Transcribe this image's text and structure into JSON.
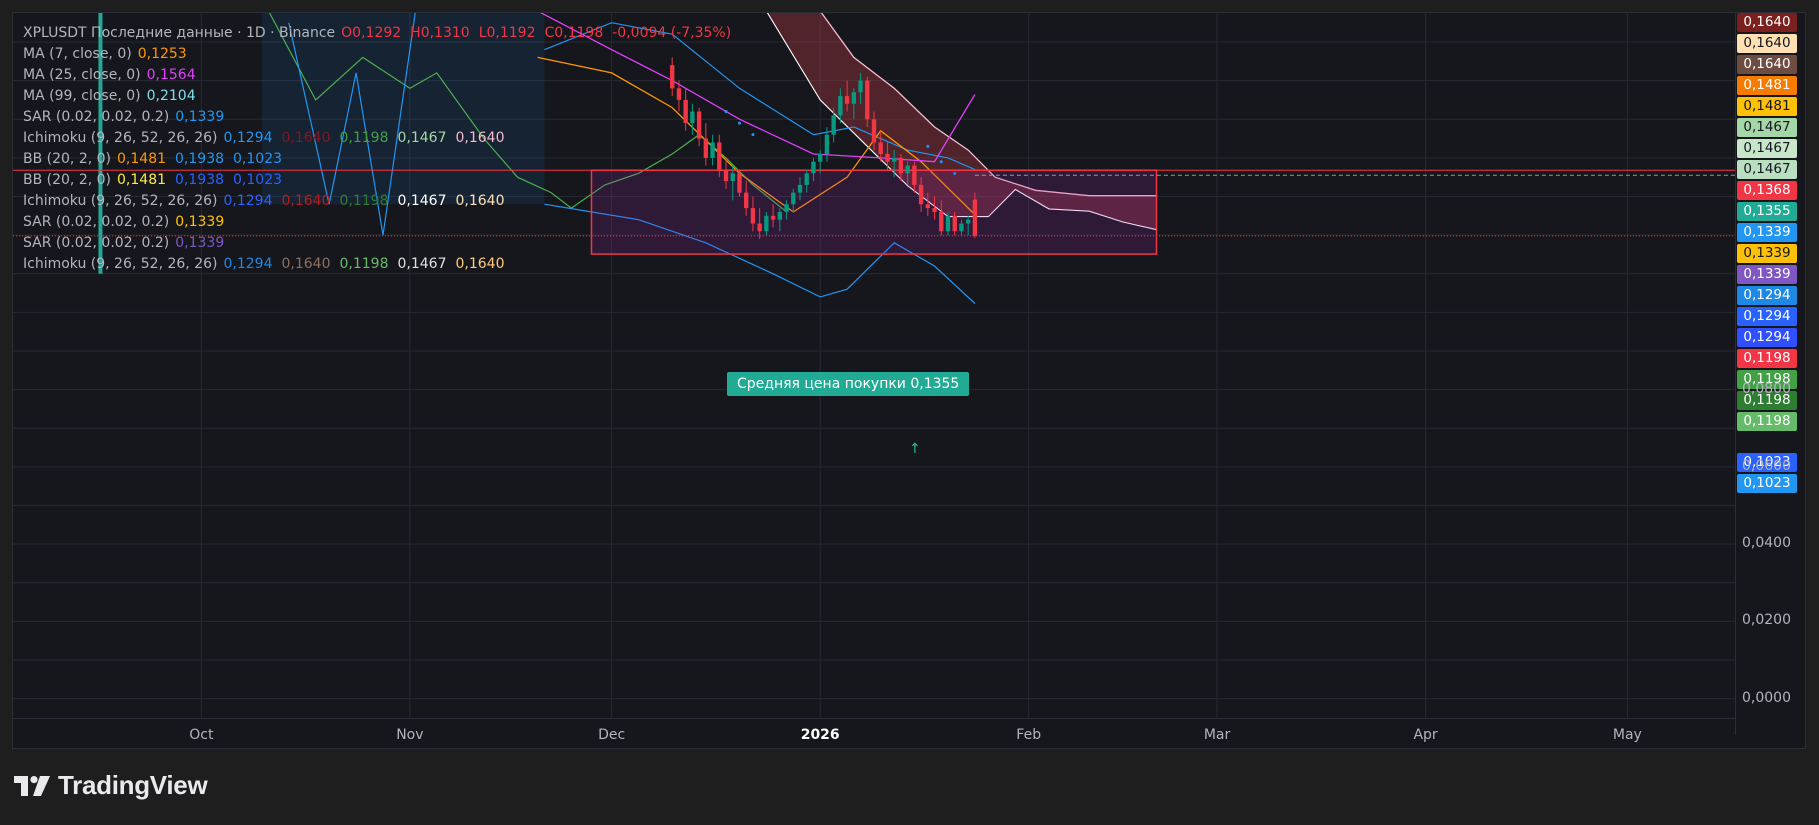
{
  "legend": [
    {
      "name": "XPLUSDT Последние данные · 1D · Binance",
      "parts": [
        {
          "t": "O0,1292",
          "c": "#f23645"
        },
        {
          "t": "H0,1310",
          "c": "#f23645"
        },
        {
          "t": "L0,1192",
          "c": "#f23645"
        },
        {
          "t": "C0,1198",
          "c": "#f23645"
        },
        {
          "t": "-0,0094 (-7,35%)",
          "c": "#f23645"
        }
      ]
    },
    {
      "name": "MA (7, close, 0)",
      "parts": [
        {
          "t": "0,1253",
          "c": "#ff9800"
        }
      ]
    },
    {
      "name": "MA (25, close, 0)",
      "parts": [
        {
          "t": "0,1564",
          "c": "#e040fb"
        }
      ]
    },
    {
      "name": "MA (99, close, 0)",
      "parts": [
        {
          "t": "0,2104",
          "c": "#80deea"
        }
      ]
    },
    {
      "name": "SAR (0.02, 0.02, 0.2)",
      "parts": [
        {
          "t": "0,1339",
          "c": "#2196f3"
        }
      ]
    },
    {
      "name": "Ichimoku (9, 26, 52, 26, 26)",
      "parts": [
        {
          "t": "0,1294",
          "c": "#2196f3"
        },
        {
          "t": "0,1640",
          "c": "#801922"
        },
        {
          "t": "0,1198",
          "c": "#43a047"
        },
        {
          "t": "0,1467",
          "c": "#a5d6a7"
        },
        {
          "t": "0,1640",
          "c": "#f8bbd0"
        }
      ]
    },
    {
      "name": "BB (20, 2, 0)",
      "parts": [
        {
          "t": "0,1481",
          "c": "#ff9800"
        },
        {
          "t": "0,1938",
          "c": "#2196f3"
        },
        {
          "t": "0,1023",
          "c": "#2196f3"
        }
      ]
    },
    {
      "name": "BB (20, 2, 0)",
      "parts": [
        {
          "t": "0,1481",
          "c": "#ffeb3b"
        },
        {
          "t": "0,1938",
          "c": "#2962ff"
        },
        {
          "t": "0,1023",
          "c": "#2962ff"
        }
      ]
    },
    {
      "name": "Ichimoku (9, 26, 52, 26, 26)",
      "parts": [
        {
          "t": "0,1294",
          "c": "#2962ff"
        },
        {
          "t": "0,1640",
          "c": "#b71c1c"
        },
        {
          "t": "0,1198",
          "c": "#2e7d32"
        },
        {
          "t": "0,1467",
          "c": "#ffffff"
        },
        {
          "t": "0,1640",
          "c": "#ffe0b2"
        }
      ]
    },
    {
      "name": "SAR (0.02, 0.02, 0.2)",
      "parts": [
        {
          "t": "0,1339",
          "c": "#ffc107"
        }
      ]
    },
    {
      "name": "SAR (0.02, 0.02, 0.2)",
      "parts": [
        {
          "t": "0,1339",
          "c": "#7e57c2"
        }
      ]
    },
    {
      "name": "Ichimoku (9, 26, 52, 26, 26)",
      "parts": [
        {
          "t": "0,1294",
          "c": "#1e88e5"
        },
        {
          "t": "0,1640",
          "c": "#8d6e63"
        },
        {
          "t": "0,1198",
          "c": "#66bb6a"
        },
        {
          "t": "0,1467",
          "c": "#e0e0e0"
        },
        {
          "t": "0,1640",
          "c": "#ffcc80"
        }
      ]
    }
  ],
  "price_labels": [
    {
      "v": "0,1640",
      "bg": "#7b1f1f",
      "fg": "#ffffff"
    },
    {
      "v": "0,1640",
      "bg": "#ffe0b2",
      "fg": "#131722"
    },
    {
      "v": "0,1640",
      "bg": "#6d4c41",
      "fg": "#ffffff"
    },
    {
      "v": "0,1481",
      "bg": "#f57c00",
      "fg": "#ffffff"
    },
    {
      "v": "0,1481",
      "bg": "#ffc107",
      "fg": "#131722"
    },
    {
      "v": "0,1467",
      "bg": "#a5d6a7",
      "fg": "#131722"
    },
    {
      "v": "0,1467",
      "bg": "#c8e6c9",
      "fg": "#131722"
    },
    {
      "v": "0,1467",
      "bg": "#b9dfc0",
      "fg": "#131722"
    },
    {
      "v": "0,1368",
      "bg": "#f23645",
      "fg": "#ffffff"
    },
    {
      "v": "0,1355",
      "bg": "#22ab94",
      "fg": "#ffffff"
    },
    {
      "v": "0,1339",
      "bg": "#2196f3",
      "fg": "#ffffff"
    },
    {
      "v": "0,1339",
      "bg": "#ffc107",
      "fg": "#131722"
    },
    {
      "v": "0,1339",
      "bg": "#7e57c2",
      "fg": "#ffffff"
    },
    {
      "v": "0,1294",
      "bg": "#1e88e5",
      "fg": "#ffffff"
    },
    {
      "v": "0,1294",
      "bg": "#2962ff",
      "fg": "#ffffff"
    },
    {
      "v": "0,1294",
      "bg": "#304ffe",
      "fg": "#ffffff"
    },
    {
      "v": "0,1198",
      "bg": "#f23645",
      "fg": "#ffffff"
    },
    {
      "v": "0,1198",
      "bg": "#43a047",
      "fg": "#ffffff"
    },
    {
      "v": "0,1198",
      "bg": "#2e7d32",
      "fg": "#ffffff"
    },
    {
      "v": "0,1198",
      "bg": "#66bb6a",
      "fg": "#ffffff"
    },
    {
      "v": "0,1023",
      "bg": "#2962ff",
      "fg": "#ffffff"
    },
    {
      "v": "0,1023",
      "bg": "#2196f3",
      "fg": "#ffffff"
    }
  ],
  "buy_label": "Средняя цена покупки 0,1355",
  "brand": "TradingView",
  "chart_data": {
    "type": "candlestick",
    "symbol": "XPLUSDT",
    "timeframe": "1D",
    "exchange": "Binance",
    "y_ticks": [
      "0,0800",
      "0,0600",
      "0,0400",
      "0,0200",
      "0,0000"
    ],
    "y_tick_values": [
      0.08,
      0.06,
      0.04,
      0.02,
      0.0
    ],
    "x_ticks": [
      {
        "label": "Oct",
        "date": "2025-10-01"
      },
      {
        "label": "Nov",
        "date": "2025-11-01"
      },
      {
        "label": "Dec",
        "date": "2025-12-01"
      },
      {
        "label": "2026",
        "date": "2026-01-01",
        "bold": true
      },
      {
        "label": "Feb",
        "date": "2026-02-01"
      },
      {
        "label": "Mar",
        "date": "2026-03-01"
      },
      {
        "label": "Apr",
        "date": "2026-04-01"
      },
      {
        "label": "May",
        "date": "2026-05-01"
      }
    ],
    "y_range": [
      -0.005,
      0.1775
    ],
    "x_range": [
      "2025-09-03",
      "2026-05-17"
    ],
    "last_close": 0.1198,
    "avg_buy_price": 0.1355,
    "rectangle": {
      "from": "2025-11-28",
      "to": "2026-02-20",
      "top": 0.1368,
      "bottom": 0.1151
    },
    "candles": [
      {
        "date": "2025-12-10",
        "o": 0.164,
        "h": 0.166,
        "l": 0.156,
        "c": 0.158
      },
      {
        "date": "2025-12-11",
        "o": 0.158,
        "h": 0.16,
        "l": 0.152,
        "c": 0.155
      },
      {
        "date": "2025-12-12",
        "o": 0.155,
        "h": 0.158,
        "l": 0.147,
        "c": 0.149
      },
      {
        "date": "2025-12-13",
        "o": 0.149,
        "h": 0.154,
        "l": 0.146,
        "c": 0.152
      },
      {
        "date": "2025-12-14",
        "o": 0.152,
        "h": 0.153,
        "l": 0.143,
        "c": 0.145
      },
      {
        "date": "2025-12-15",
        "o": 0.145,
        "h": 0.149,
        "l": 0.138,
        "c": 0.14
      },
      {
        "date": "2025-12-16",
        "o": 0.14,
        "h": 0.146,
        "l": 0.138,
        "c": 0.144
      },
      {
        "date": "2025-12-17",
        "o": 0.144,
        "h": 0.146,
        "l": 0.135,
        "c": 0.137
      },
      {
        "date": "2025-12-18",
        "o": 0.137,
        "h": 0.14,
        "l": 0.132,
        "c": 0.134
      },
      {
        "date": "2025-12-19",
        "o": 0.134,
        "h": 0.138,
        "l": 0.129,
        "c": 0.136
      },
      {
        "date": "2025-12-20",
        "o": 0.136,
        "h": 0.137,
        "l": 0.13,
        "c": 0.131
      },
      {
        "date": "2025-12-21",
        "o": 0.131,
        "h": 0.134,
        "l": 0.125,
        "c": 0.127
      },
      {
        "date": "2025-12-22",
        "o": 0.127,
        "h": 0.13,
        "l": 0.121,
        "c": 0.123
      },
      {
        "date": "2025-12-23",
        "o": 0.123,
        "h": 0.127,
        "l": 0.119,
        "c": 0.121
      },
      {
        "date": "2025-12-24",
        "o": 0.121,
        "h": 0.126,
        "l": 0.12,
        "c": 0.125
      },
      {
        "date": "2025-12-25",
        "o": 0.125,
        "h": 0.128,
        "l": 0.122,
        "c": 0.124
      },
      {
        "date": "2025-12-26",
        "o": 0.124,
        "h": 0.127,
        "l": 0.121,
        "c": 0.126
      },
      {
        "date": "2025-12-27",
        "o": 0.126,
        "h": 0.129,
        "l": 0.124,
        "c": 0.128
      },
      {
        "date": "2025-12-28",
        "o": 0.128,
        "h": 0.132,
        "l": 0.126,
        "c": 0.131
      },
      {
        "date": "2025-12-29",
        "o": 0.131,
        "h": 0.135,
        "l": 0.129,
        "c": 0.133
      },
      {
        "date": "2025-12-30",
        "o": 0.133,
        "h": 0.137,
        "l": 0.131,
        "c": 0.136
      },
      {
        "date": "2025-12-31",
        "o": 0.136,
        "h": 0.14,
        "l": 0.134,
        "c": 0.139
      },
      {
        "date": "2026-01-01",
        "o": 0.139,
        "h": 0.142,
        "l": 0.136,
        "c": 0.141
      },
      {
        "date": "2026-01-02",
        "o": 0.141,
        "h": 0.148,
        "l": 0.139,
        "c": 0.146
      },
      {
        "date": "2026-01-03",
        "o": 0.146,
        "h": 0.153,
        "l": 0.144,
        "c": 0.151
      },
      {
        "date": "2026-01-04",
        "o": 0.151,
        "h": 0.158,
        "l": 0.149,
        "c": 0.156
      },
      {
        "date": "2026-01-05",
        "o": 0.156,
        "h": 0.16,
        "l": 0.152,
        "c": 0.154
      },
      {
        "date": "2026-01-06",
        "o": 0.154,
        "h": 0.158,
        "l": 0.15,
        "c": 0.157
      },
      {
        "date": "2026-01-07",
        "o": 0.157,
        "h": 0.162,
        "l": 0.154,
        "c": 0.16
      },
      {
        "date": "2026-01-08",
        "o": 0.16,
        "h": 0.161,
        "l": 0.148,
        "c": 0.15
      },
      {
        "date": "2026-01-09",
        "o": 0.15,
        "h": 0.152,
        "l": 0.142,
        "c": 0.144
      },
      {
        "date": "2026-01-10",
        "o": 0.144,
        "h": 0.147,
        "l": 0.139,
        "c": 0.141
      },
      {
        "date": "2026-01-11",
        "o": 0.141,
        "h": 0.144,
        "l": 0.137,
        "c": 0.139
      },
      {
        "date": "2026-01-12",
        "o": 0.139,
        "h": 0.142,
        "l": 0.135,
        "c": 0.14
      },
      {
        "date": "2026-01-13",
        "o": 0.14,
        "h": 0.141,
        "l": 0.134,
        "c": 0.136
      },
      {
        "date": "2026-01-14",
        "o": 0.136,
        "h": 0.139,
        "l": 0.133,
        "c": 0.138
      },
      {
        "date": "2026-01-15",
        "o": 0.138,
        "h": 0.139,
        "l": 0.131,
        "c": 0.133
      },
      {
        "date": "2026-01-16",
        "o": 0.133,
        "h": 0.135,
        "l": 0.126,
        "c": 0.128
      },
      {
        "date": "2026-01-17",
        "o": 0.128,
        "h": 0.131,
        "l": 0.125,
        "c": 0.127
      },
      {
        "date": "2026-01-18",
        "o": 0.127,
        "h": 0.13,
        "l": 0.124,
        "c": 0.126
      },
      {
        "date": "2026-01-19",
        "o": 0.126,
        "h": 0.129,
        "l": 0.12,
        "c": 0.121
      },
      {
        "date": "2026-01-20",
        "o": 0.121,
        "h": 0.126,
        "l": 0.12,
        "c": 0.125
      },
      {
        "date": "2026-01-21",
        "o": 0.125,
        "h": 0.126,
        "l": 0.12,
        "c": 0.121
      },
      {
        "date": "2026-01-22",
        "o": 0.121,
        "h": 0.124,
        "l": 0.12,
        "c": 0.123
      },
      {
        "date": "2026-01-23",
        "o": 0.123,
        "h": 0.125,
        "l": 0.12,
        "c": 0.124
      },
      {
        "date": "2026-01-24",
        "o": 0.1292,
        "h": 0.131,
        "l": 0.1192,
        "c": 0.1198
      }
    ],
    "series": [
      {
        "name": "MA (7, close, 0)",
        "color": "#ff9800",
        "points": [
          [
            "2025-11-20",
            0.166
          ],
          [
            "2025-12-01",
            0.162
          ],
          [
            "2025-12-10",
            0.153
          ],
          [
            "2025-12-20",
            0.136
          ],
          [
            "2025-12-28",
            0.126
          ],
          [
            "2026-01-05",
            0.135
          ],
          [
            "2026-01-10",
            0.147
          ],
          [
            "2026-01-16",
            0.139
          ],
          [
            "2026-01-24",
            0.1253
          ]
        ]
      },
      {
        "name": "MA (25, close, 0)",
        "color": "#e040fb",
        "points": [
          [
            "2025-11-20",
            0.178
          ],
          [
            "2025-12-01",
            0.168
          ],
          [
            "2025-12-10",
            0.16
          ],
          [
            "2025-12-20",
            0.15
          ],
          [
            "2025-12-31",
            0.141
          ],
          [
            "2026-01-10",
            0.14
          ],
          [
            "2026-01-18",
            0.139
          ],
          [
            "2026-01-24",
            0.1564
          ]
        ]
      }
    ]
  }
}
